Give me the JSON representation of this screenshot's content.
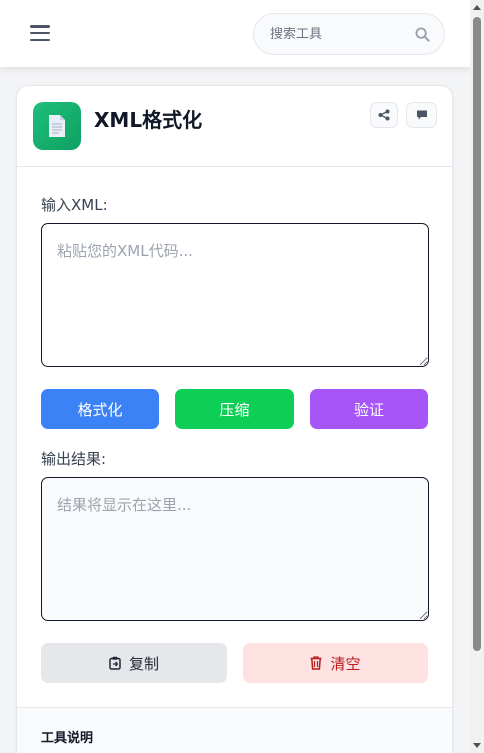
{
  "topbar": {
    "menu_icon": "hamburger-menu-icon",
    "search_placeholder": "搜索工具",
    "search_icon": "search-icon"
  },
  "tool": {
    "icon": "document-icon",
    "title": "XML格式化",
    "share_icon": "share-icon",
    "comment_icon": "comment-icon",
    "icon_color": "#1fbf7a"
  },
  "input": {
    "label": "输入XML:",
    "placeholder": "粘贴您的XML代码..."
  },
  "actions": {
    "format_label": "格式化",
    "compress_label": "压缩",
    "validate_label": "验证",
    "format_color": "#3b82f6",
    "compress_color": "#0ecf55",
    "validate_color": "#a855f7"
  },
  "output": {
    "label": "输出结果:",
    "placeholder": "结果将显示在这里..."
  },
  "bottom": {
    "copy_label": "复制",
    "copy_icon": "clipboard-icon",
    "clear_label": "清空",
    "clear_icon": "trash-icon"
  },
  "info": {
    "title": "工具说明"
  }
}
